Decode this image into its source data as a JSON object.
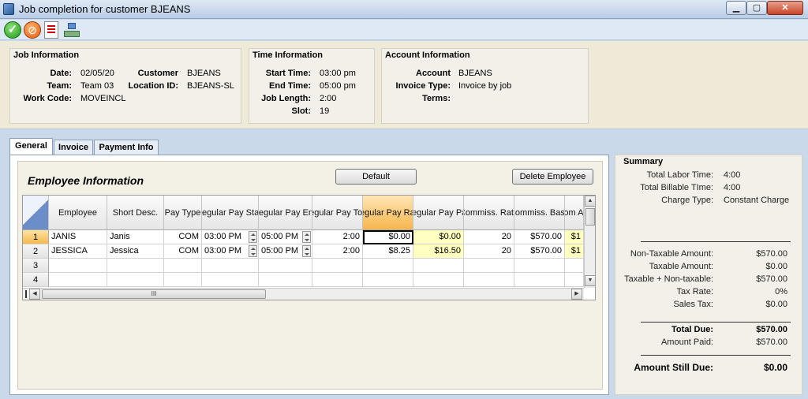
{
  "window": {
    "title": "Job completion for customer BJEANS"
  },
  "job_info": {
    "title": "Job Information",
    "date_label": "Date:",
    "date": "02/05/20",
    "team_label": "Team:",
    "team": "Team 03",
    "work_code_label": "Work Code:",
    "work_code": "MOVEINCL",
    "customer_label": "Customer",
    "customer": "BJEANS",
    "location_label": "Location ID:",
    "location": "BJEANS-SL"
  },
  "time_info": {
    "title": "Time Information",
    "start_label": "Start Time:",
    "start": "03:00 pm",
    "end_label": "End Time:",
    "end": "05:00 pm",
    "length_label": "Job Length:",
    "length": "2:00",
    "slot_label": "Slot:",
    "slot": "19"
  },
  "account_info": {
    "title": "Account Information",
    "account_label": "Account",
    "account": "BJEANS",
    "invoice_type_label": "Invoice Type:",
    "invoice_type": "Invoice by job",
    "terms_label": "Terms:",
    "terms": ""
  },
  "tabs": [
    {
      "label": "General",
      "active": true
    },
    {
      "label": "Invoice",
      "active": false
    },
    {
      "label": "Payment Info",
      "active": false
    }
  ],
  "employee_section": {
    "title": "Employee Information",
    "default_button": "Default",
    "delete_button": "Delete Employee"
  },
  "grid": {
    "headers": {
      "employee": "Employee",
      "short_desc": "Short Desc.",
      "pay_type": "Pay Type",
      "reg_start": "Regular Pay Start",
      "reg_end": "Regular Pay End",
      "reg_total": "Regular Pay Total",
      "reg_rate": "Regular Pay Rate",
      "reg_pay": "Regular Pay Pay",
      "comm_rate": "Commiss. Rate",
      "comm_base": "Commiss. Base",
      "comm_amt": "Com Am"
    },
    "rows": [
      {
        "num": "1",
        "employee": "JANIS",
        "short": "Janis",
        "pay_type": "COM",
        "start": "03:00 PM",
        "end": "05:00 PM",
        "total": "2:00",
        "rate": "$0.00",
        "pay": "$0.00",
        "comm_rate": "20",
        "comm_base": "$570.00",
        "comm_amt": "$1"
      },
      {
        "num": "2",
        "employee": "JESSICA",
        "short": "Jessica",
        "pay_type": "COM",
        "start": "03:00 PM",
        "end": "05:00 PM",
        "total": "2:00",
        "rate": "$8.25",
        "pay": "$16.50",
        "comm_rate": "20",
        "comm_base": "$570.00",
        "comm_amt": "$1"
      },
      {
        "num": "3"
      },
      {
        "num": "4"
      }
    ],
    "hscroll_grip": "III"
  },
  "summary": {
    "title": "Summary",
    "total_labor_label": "Total Labor Time:",
    "total_labor": "4:00",
    "total_billable_label": "Total Billable TIme:",
    "total_billable": "4:00",
    "charge_type_label": "Charge Type:",
    "charge_type": "Constant Charge",
    "non_taxable_label": "Non-Taxable Amount:",
    "non_taxable": "$570.00",
    "taxable_label": "Taxable Amount:",
    "taxable": "$0.00",
    "tax_plus_non_label": "Taxable + Non-taxable:",
    "tax_plus_non": "$570.00",
    "tax_rate_label": "Tax Rate:",
    "tax_rate": "0%",
    "sales_tax_label": "Sales Tax:",
    "sales_tax": "$0.00",
    "total_due_label": "Total Due:",
    "total_due": "$570.00",
    "amount_paid_label": "Amount Paid:",
    "amount_paid": "$570.00",
    "still_due_label": "Amount Still Due:",
    "still_due": "$0.00"
  }
}
